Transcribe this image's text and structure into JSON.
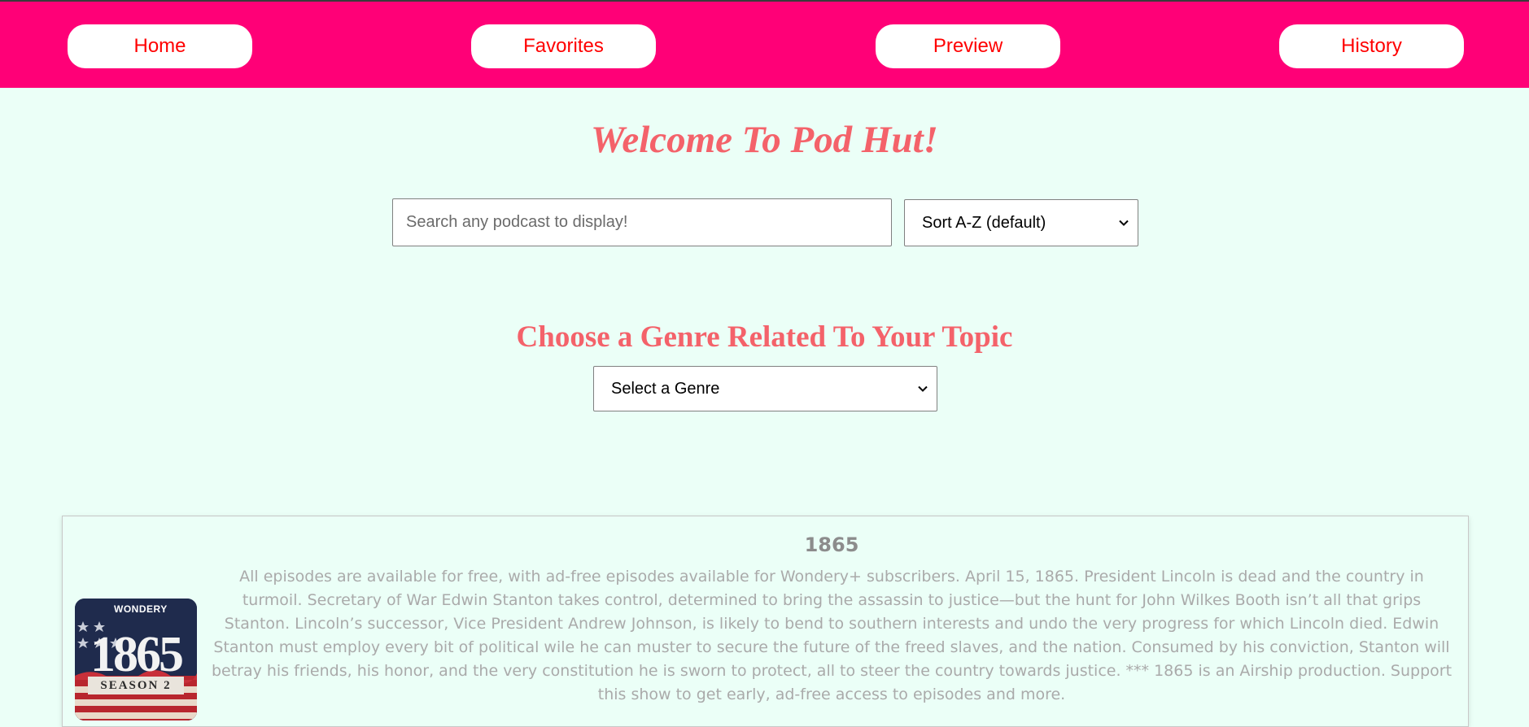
{
  "nav": {
    "items": [
      {
        "label": "Home"
      },
      {
        "label": "Favorites"
      },
      {
        "label": "Preview"
      },
      {
        "label": "History"
      }
    ]
  },
  "header": {
    "welcome": "Welcome To Pod Hut!"
  },
  "search": {
    "placeholder": "Search any podcast to display!",
    "value": ""
  },
  "sort": {
    "selected": "Sort A-Z (default)"
  },
  "genre": {
    "heading": "Choose a Genre Related To Your Topic",
    "selected": "Select a Genre"
  },
  "podcast": {
    "title": "1865",
    "description": "All episodes are available for free, with ad-free episodes available for Wondery+ subscribers. April 15, 1865. President Lincoln is dead and the country in turmoil. Secretary of War Edwin Stanton takes control, determined to bring the assassin to justice—but the hunt for John Wilkes Booth isn’t all that grips Stanton. Lincoln’s successor, Vice President Andrew Johnson, is likely to bend to southern interests and undo the very progress for which Lincoln died. Edwin Stanton must employ every bit of political wile he can muster to secure the future of the freed slaves, and the nation. Consumed by his conviction, Stanton will betray his friends, his honor, and the very constitution he is sworn to protect, all to steer the country towards justice. *** 1865 is an Airship production. Support this show to get early, ad-free access to episodes and more.",
    "cover": {
      "brand": "WONDERY",
      "big_text": "1865",
      "season": "SEASON 2"
    }
  },
  "colors": {
    "topbar": "#ff0077",
    "background": "#ebfff7",
    "nav_text": "#ff0000",
    "heading": "#f4626a"
  }
}
